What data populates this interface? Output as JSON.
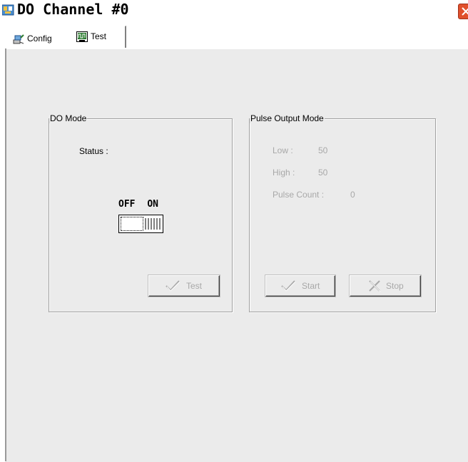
{
  "window": {
    "title": "DO Channel #0",
    "icon": "app-icon",
    "close_icon": "close-icon"
  },
  "tabs": [
    {
      "label": "Config",
      "icon": "network-config-icon",
      "selected": false
    },
    {
      "label": "Test",
      "icon": "waveform-icon",
      "selected": true
    }
  ],
  "do_mode": {
    "legend": "DO Mode",
    "status_label": "Status :",
    "toggle_off": "OFF",
    "toggle_on": "ON",
    "toggle_state": "OFF",
    "test_button": "Test"
  },
  "pulse_mode": {
    "legend": "Pulse Output Mode",
    "low_label": "Low :",
    "low_value": "50",
    "high_label": "High :",
    "high_value": "50",
    "pulse_count_label": "Pulse Count :",
    "pulse_count_value": "0",
    "start_button": "Start",
    "stop_button": "Stop"
  },
  "colors": {
    "panel_bg": "#ebebeb",
    "disabled_text": "#a8a8a8",
    "close_button": "#e0502c"
  }
}
